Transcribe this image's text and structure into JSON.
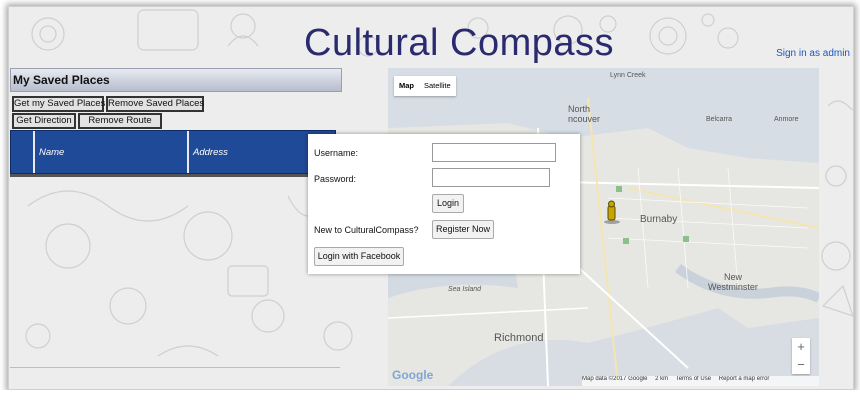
{
  "app": {
    "title": "Cultural Compass",
    "signin_label": "Sign in as admin"
  },
  "panel": {
    "title": "My Saved Places",
    "buttons": {
      "get_saved": "Get my Saved Places",
      "remove_saved": "Remove Saved Places",
      "get_direction": "Get Direction",
      "remove_route": "Remove Route"
    },
    "table": {
      "columns": [
        "",
        "Name",
        "Address"
      ]
    }
  },
  "map": {
    "type_controls": [
      "Map",
      "Satellite"
    ],
    "labels": {
      "lynn_creek": "Lynn Creek",
      "north_vancouver": "North",
      "north_vancouver2": "ncouver",
      "belcarra": "Belcarra",
      "anmore": "Anmore",
      "burnaby": "Burnaby",
      "new_west": "New",
      "new_west2": "Westminster",
      "sea_island": "Sea Island",
      "richmond": "Richmond"
    },
    "zoom_in": "+",
    "zoom_out": "−",
    "logo": "Google",
    "footer": [
      "Map data ©2017 Google",
      "2 km",
      "Terms of Use",
      "Report a map error"
    ]
  },
  "login": {
    "username_label": "Username:",
    "password_label": "Password:",
    "username_value": "",
    "password_value": "",
    "login_button": "Login",
    "new_user_label": "New to CulturalCompass?",
    "register_button": "Register Now",
    "facebook_button": "Login with Facebook"
  }
}
